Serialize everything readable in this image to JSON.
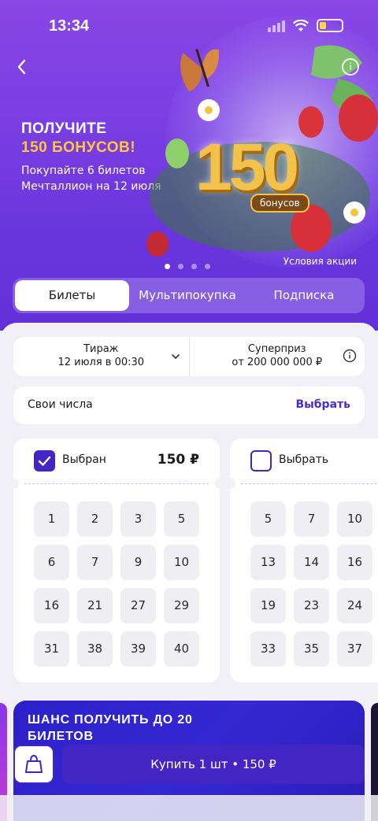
{
  "status_bar": {
    "time": "13:34"
  },
  "banner": {
    "title_line1": "ПОЛУЧИТЕ",
    "title_line2": "150 БОНУСОВ!",
    "subtitle": "Покупайте 6 билетов Мечталлион на 12 июля",
    "big_number": "150",
    "bonus_label": "бонусов",
    "conditions_link": "Условия акции",
    "slides_total": 4,
    "active_slide": 1
  },
  "tabs": [
    {
      "label": "Билеты",
      "active": true
    },
    {
      "label": "Мультипокупка",
      "active": false
    },
    {
      "label": "Подписка",
      "active": false
    }
  ],
  "draw": {
    "label": "Тираж",
    "value": "12 июля в 00:30",
    "superprize_label": "Суперприз",
    "superprize_value": "от 200 000 000 ₽"
  },
  "own_numbers": {
    "label": "Свои числа",
    "action": "Выбрать"
  },
  "tickets": [
    {
      "status": "Выбран",
      "price": "150 ₽",
      "selected": true,
      "numbers": [
        "1",
        "2",
        "3",
        "5",
        "6",
        "7",
        "9",
        "10",
        "16",
        "21",
        "27",
        "29",
        "31",
        "38",
        "39",
        "40"
      ]
    },
    {
      "status": "Выбрать",
      "selected": false,
      "numbers": [
        "5",
        "7",
        "10",
        "13",
        "14",
        "16",
        "19",
        "23",
        "24",
        "33",
        "35",
        "37"
      ]
    }
  ],
  "promo": {
    "text": "ШАНС ПОЛУЧИТЬ ДО 20 БИЛЕТОВ"
  },
  "buy": {
    "label": "Купить 1 шт • 150 ₽"
  },
  "colors": {
    "accent": "#4325c4",
    "hero": "#7b3fe2",
    "gold": "#ffc83a"
  }
}
